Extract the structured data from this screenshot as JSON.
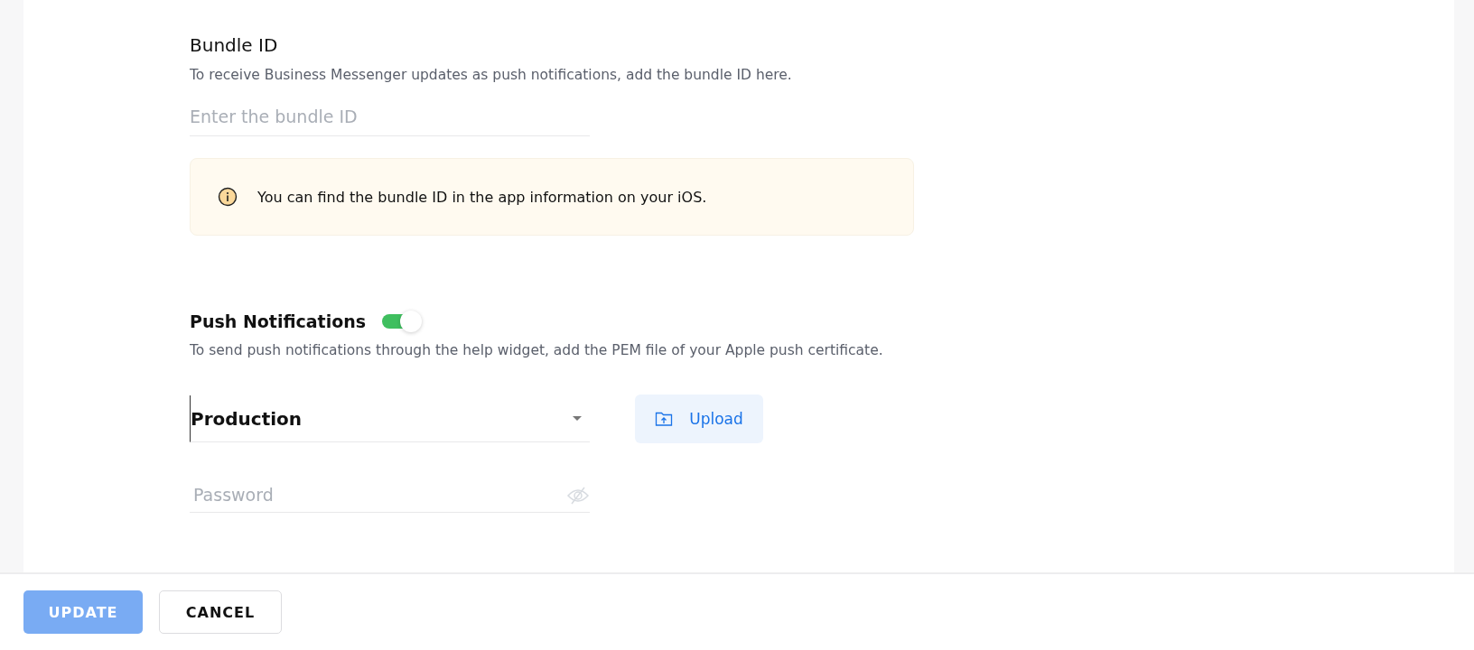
{
  "bundle_section": {
    "title": "Bundle ID",
    "description": "To receive Business Messenger updates as push notifications, add the bundle ID here.",
    "input": {
      "placeholder": "Enter the bundle ID"
    },
    "info_note": "You can find the bundle ID in the app information on your iOS."
  },
  "push_section": {
    "title": "Push Notifications",
    "toggle": {
      "on": true
    },
    "description": "To send push notifications through the help widget, add the PEM file of your Apple push certificate.",
    "environment_select": {
      "value": "Production"
    },
    "upload_button": "Upload",
    "password": {
      "placeholder": "Password"
    }
  },
  "footer": {
    "buttons": [
      {
        "label": "UPDATE",
        "kind": "primary",
        "disabled": true
      },
      {
        "label": "CANCEL",
        "kind": "secondary",
        "disabled": false
      }
    ]
  }
}
